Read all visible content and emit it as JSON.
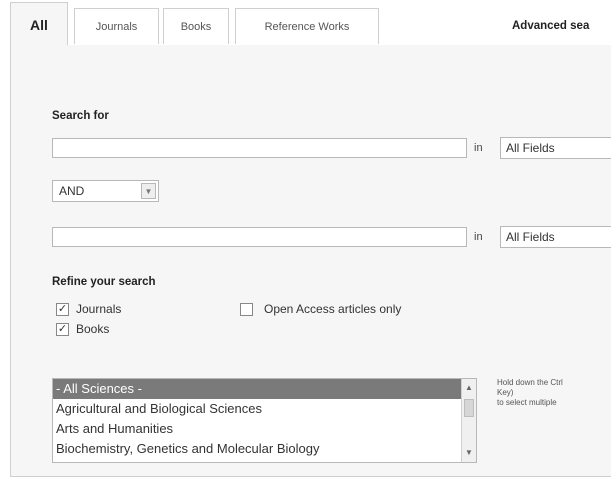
{
  "tabs": [
    {
      "label": "All",
      "active": true
    },
    {
      "label": "Journals",
      "active": false
    },
    {
      "label": "Books",
      "active": false
    },
    {
      "label": "Reference Works",
      "active": false
    }
  ],
  "page_title": "Advanced sea",
  "search": {
    "label": "Search for",
    "term1": {
      "value": "",
      "in_label": "in",
      "field": "All Fields"
    },
    "operator": {
      "value": "AND",
      "arrow": "chevron-down-icon"
    },
    "term2": {
      "value": "",
      "in_label": "in",
      "field": "All Fields"
    }
  },
  "refine": {
    "label": "Refine your search",
    "options": [
      {
        "label": "Journals",
        "checked": true
      },
      {
        "label": "Books",
        "checked": true
      },
      {
        "label": "Open Access articles only",
        "checked": false
      }
    ],
    "check_glyph": "✓"
  },
  "subjects": {
    "items": [
      "- All Sciences -",
      "Agricultural and Biological Sciences",
      "Arts and Humanities",
      "Biochemistry, Genetics and Molecular Biology"
    ],
    "selected_index": 0,
    "hint_lines": [
      "Hold down the Ctrl",
      "Key)",
      "to select multiple"
    ]
  },
  "colors": {
    "panel_bg": "#f6f6f6",
    "selected_item_bg": "#7a7a7a",
    "border": "#cfcfcf"
  }
}
